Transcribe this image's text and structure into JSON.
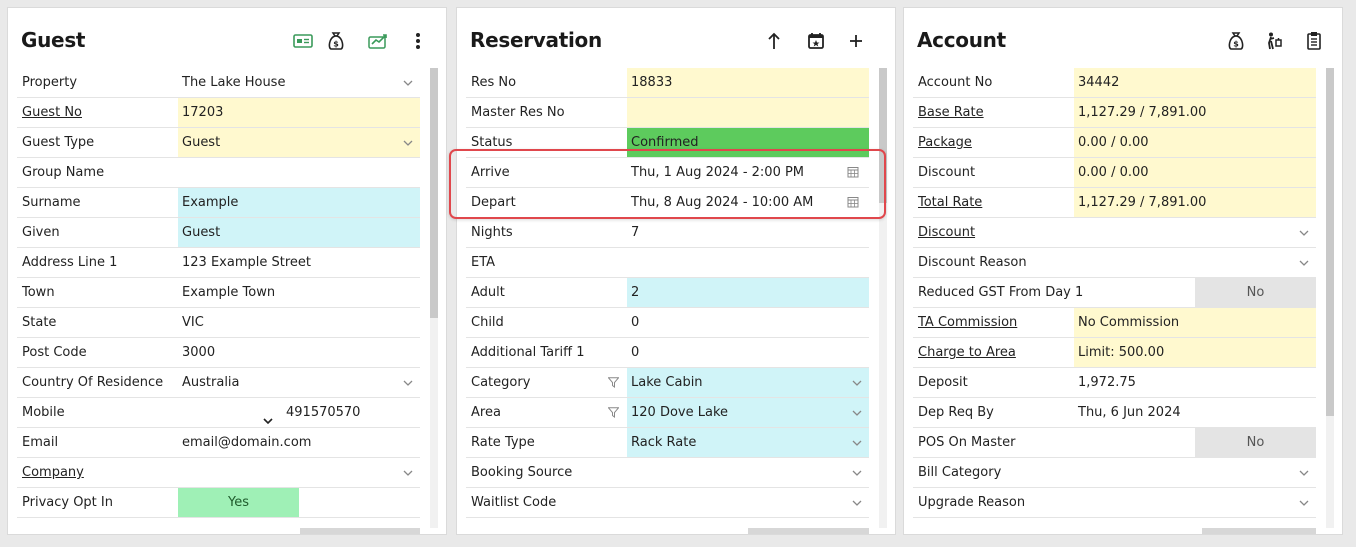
{
  "guest": {
    "title": "Guest",
    "header_icons": [
      "id-card-icon",
      "money-bag-icon",
      "chart-card-icon",
      "more-vertical-icon"
    ],
    "rows": [
      {
        "label": "Property",
        "value": "The Lake House",
        "dropdown": true
      },
      {
        "label": "Guest No",
        "value": "17203",
        "link": true,
        "bg": "yellow"
      },
      {
        "label": "Guest Type",
        "value": "Guest",
        "bg": "yellow",
        "dropdown": true
      },
      {
        "label": "Group Name",
        "value": ""
      },
      {
        "label": "Surname",
        "value": "Example",
        "bg": "cyan"
      },
      {
        "label": "Given",
        "value": "Guest",
        "bg": "cyan"
      },
      {
        "label": "Address Line 1",
        "value": "123 Example Street"
      },
      {
        "label": "Town",
        "value": "Example Town"
      },
      {
        "label": "State",
        "value": "VIC"
      },
      {
        "label": "Post Code",
        "value": "3000"
      },
      {
        "label": "Country Of Residence",
        "value": "Australia",
        "dropdown": true
      },
      {
        "label": "Mobile",
        "value": "491570570"
      },
      {
        "label": "Email",
        "value": "email@domain.com"
      },
      {
        "label": "Company",
        "value": "",
        "link": true,
        "dropdown": true
      },
      {
        "label": "Privacy Opt In",
        "toggle": "Yes"
      }
    ]
  },
  "reservation": {
    "title": "Reservation",
    "header_icons": [
      "arrow-up-icon",
      "calendar-star-icon",
      "plus-icon"
    ],
    "rows": [
      {
        "label": "Res No",
        "value": "18833",
        "bg": "yellow"
      },
      {
        "label": "Master Res No",
        "value": "",
        "bg": "yellow"
      },
      {
        "label": "Status",
        "value": "Confirmed",
        "bg": "green"
      },
      {
        "label": "Arrive",
        "value": "Thu, 1 Aug 2024 - 2:00 PM",
        "calendar": true
      },
      {
        "label": "Depart",
        "value": "Thu, 8 Aug 2024 - 10:00 AM",
        "calendar": true
      },
      {
        "label": "Nights",
        "value": "7"
      },
      {
        "label": "ETA",
        "value": ""
      },
      {
        "label": "Adult",
        "value": "2",
        "bg": "cyan"
      },
      {
        "label": "Child",
        "value": "0"
      },
      {
        "label": "Additional Tariff 1",
        "value": "0"
      },
      {
        "label": "Category",
        "value": "Lake Cabin",
        "bg": "cyan",
        "dropdown": true,
        "filter": true
      },
      {
        "label": "Area",
        "value": "120 Dove Lake",
        "bg": "cyan",
        "dropdown": true,
        "filter": true
      },
      {
        "label": "Rate Type",
        "value": "Rack Rate",
        "bg": "cyan",
        "dropdown": true
      },
      {
        "label": "Booking Source",
        "value": "",
        "dropdown": true
      },
      {
        "label": "Waitlist Code",
        "value": "",
        "dropdown": true
      }
    ]
  },
  "account": {
    "title": "Account",
    "header_icons": [
      "money-bag-icon",
      "person-luggage-icon",
      "clipboard-icon"
    ],
    "rows": [
      {
        "label": "Account No",
        "value": "34442",
        "bg": "yellow"
      },
      {
        "label": "Base Rate",
        "value": "1,127.29 / 7,891.00",
        "link": true,
        "bg": "yellow"
      },
      {
        "label": "Package",
        "value": "0.00 / 0.00",
        "link": true,
        "bg": "yellow"
      },
      {
        "label": "Discount",
        "value": "0.00 / 0.00",
        "bg": "yellow"
      },
      {
        "label": "Total Rate",
        "value": "1,127.29 / 7,891.00",
        "link": true,
        "bg": "yellow"
      },
      {
        "label": "Discount",
        "value": "",
        "link": true,
        "dropdown": true
      },
      {
        "label": "Discount Reason",
        "value": "",
        "dropdown": true
      },
      {
        "label": "Reduced GST From Day 1",
        "toggle_no": "No"
      },
      {
        "label": "TA Commission",
        "value": "No Commission",
        "link": true,
        "bg": "yellow"
      },
      {
        "label": "Charge to Area",
        "value": "Limit: 500.00",
        "link": true,
        "bg": "yellow"
      },
      {
        "label": "Deposit",
        "value": "1,972.75"
      },
      {
        "label": "Dep Req By",
        "value": "Thu, 6 Jun 2024"
      },
      {
        "label": "POS On Master",
        "toggle_no": "No"
      },
      {
        "label": "Bill Category",
        "value": "",
        "dropdown": true
      },
      {
        "label": "Upgrade Reason",
        "value": "",
        "dropdown": true
      }
    ]
  }
}
